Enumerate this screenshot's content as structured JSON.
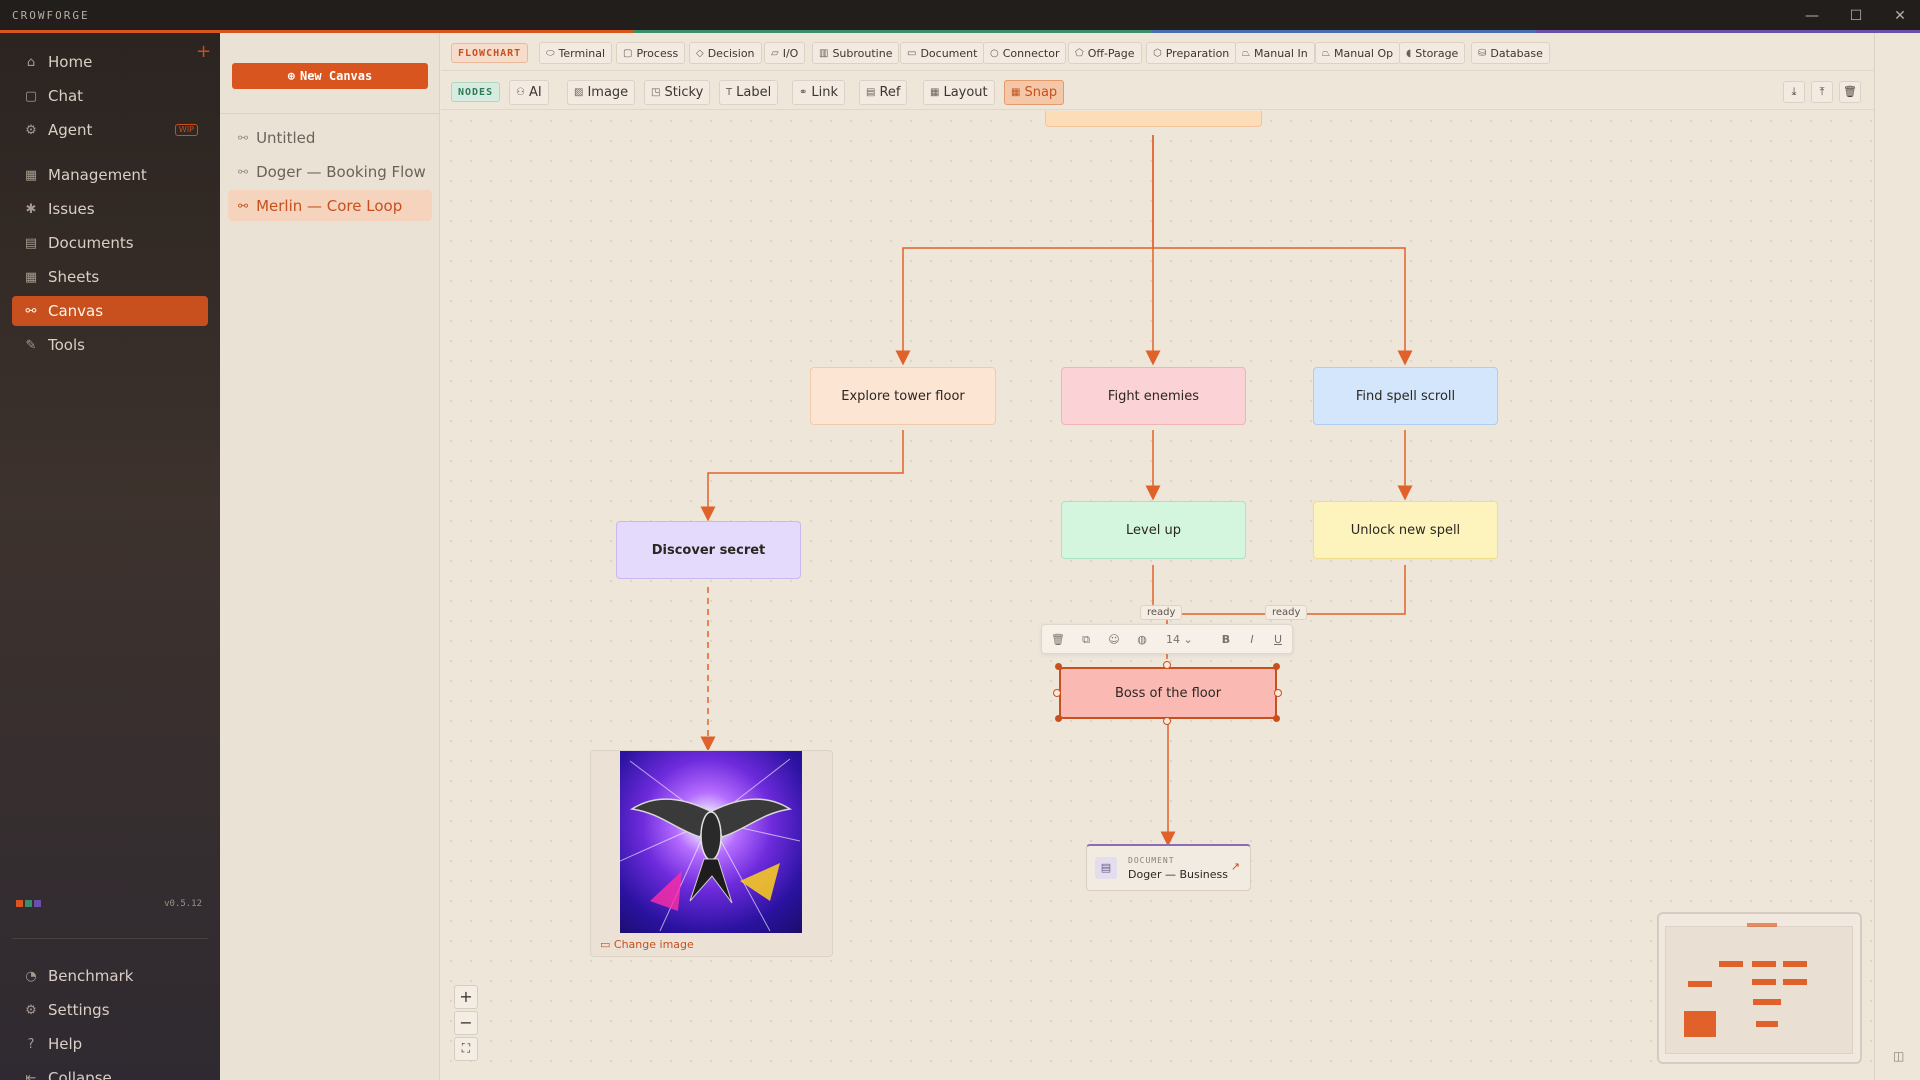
{
  "app": {
    "brand": "CROWFORGE",
    "version": "v0.5.12"
  },
  "window_controls": {
    "minimize": "—",
    "maximize": "☐",
    "close": "✕"
  },
  "sidebar": {
    "items": [
      {
        "label": "Home",
        "icon": "home-icon",
        "glyph": "⌂"
      },
      {
        "label": "Chat",
        "icon": "chat-icon",
        "glyph": "▢"
      },
      {
        "label": "Agent",
        "icon": "robot-icon",
        "glyph": "⚙",
        "badge": "WIP"
      },
      {
        "label": "Management",
        "icon": "grid-icon",
        "glyph": "▦"
      },
      {
        "label": "Issues",
        "icon": "bug-icon",
        "glyph": "✱"
      },
      {
        "label": "Documents",
        "icon": "document-icon",
        "glyph": "▤"
      },
      {
        "label": "Sheets",
        "icon": "table-icon",
        "glyph": "▦"
      },
      {
        "label": "Canvas",
        "icon": "canvas-icon",
        "glyph": "⚯",
        "active": true
      },
      {
        "label": "Tools",
        "icon": "wrench-icon",
        "glyph": "✎"
      }
    ],
    "bottom_items": [
      {
        "label": "Benchmark",
        "icon": "gauge-icon",
        "glyph": "◔"
      },
      {
        "label": "Settings",
        "icon": "gear-icon",
        "glyph": "⚙"
      },
      {
        "label": "Help",
        "icon": "help-icon",
        "glyph": "?"
      },
      {
        "label": "Collapse",
        "icon": "collapse-icon",
        "glyph": "⇤"
      }
    ],
    "add_glyph": "+",
    "swatch_colors": [
      "#d9551f",
      "#3a8f6a",
      "#6b4fa8"
    ]
  },
  "panel": {
    "new_canvas_label": "New Canvas",
    "new_canvas_glyph": "⊕",
    "canvases": [
      {
        "label": "Untitled"
      },
      {
        "label": "Doger — Booking Flow"
      },
      {
        "label": "Merlin — Core Loop",
        "active": true
      }
    ]
  },
  "toolbar_flowchart": {
    "tag": "FLOWCHART",
    "buttons": [
      {
        "label": "Terminal",
        "glyph": "⬭"
      },
      {
        "label": "Process",
        "glyph": "▢"
      },
      {
        "label": "Decision",
        "glyph": "◇"
      },
      {
        "label": "I/O",
        "glyph": "▱"
      },
      {
        "label": "Subroutine",
        "glyph": "▥"
      },
      {
        "label": "Document",
        "glyph": "▭"
      },
      {
        "label": "Connector",
        "glyph": "○"
      },
      {
        "label": "Off-Page",
        "glyph": "⬠"
      },
      {
        "label": "Preparation",
        "glyph": "⬡"
      },
      {
        "label": "Manual In",
        "glyph": "⏢"
      },
      {
        "label": "Manual Op",
        "glyph": "⏢"
      },
      {
        "label": "Storage",
        "glyph": "◖"
      },
      {
        "label": "Database",
        "glyph": "⛁"
      }
    ]
  },
  "toolbar_nodes": {
    "tag": "NODES",
    "buttons": [
      {
        "label": "AI",
        "glyph": "⚇"
      },
      {
        "label": "Image",
        "glyph": "▨"
      },
      {
        "label": "Sticky",
        "glyph": "◳"
      },
      {
        "label": "Label",
        "glyph": "T"
      },
      {
        "label": "Link",
        "glyph": "⚭"
      },
      {
        "label": "Ref",
        "glyph": "▤"
      },
      {
        "label": "Layout",
        "glyph": "▦"
      },
      {
        "label": "Snap",
        "glyph": "▦",
        "active": true
      }
    ],
    "right_actions": [
      {
        "name": "download",
        "glyph": "⤓"
      },
      {
        "name": "upload",
        "glyph": "⤒"
      },
      {
        "name": "delete",
        "glyph": "🗑"
      }
    ]
  },
  "nodes": [
    {
      "id": "explore",
      "label": "Explore tower floor",
      "fill": "#fde5d4",
      "border": "#f3c9ad"
    },
    {
      "id": "fight",
      "label": "Fight enemies",
      "fill": "#fbd3d6",
      "border": "#f0b3b8"
    },
    {
      "id": "find",
      "label": "Find spell scroll",
      "fill": "#d3e6fb",
      "border": "#aecdef"
    },
    {
      "id": "secret",
      "label": "Discover secret",
      "fill": "#e4dafb",
      "border": "#c9b8f0",
      "bold": true
    },
    {
      "id": "levelup",
      "label": "Level up",
      "fill": "#d4f6df",
      "border": "#a9e3bf"
    },
    {
      "id": "unlock",
      "label": "Unlock new spell",
      "fill": "#fdf3bd",
      "border": "#f0dd8a"
    },
    {
      "id": "boss",
      "label": "Boss of the floor",
      "fill": "#fbb9b4",
      "border": "#c8501e"
    }
  ],
  "edge_labels": [
    "ready",
    "ready"
  ],
  "format_bar": {
    "font_size": "14",
    "glyphs": [
      "🗑",
      "⧉",
      "☺",
      "◍",
      "B",
      "I",
      "U"
    ]
  },
  "image_node": {
    "change_label": "Change image",
    "change_glyph": "▭"
  },
  "doc_node": {
    "type": "DOCUMENT",
    "title": "Doger — Business",
    "glyph": "▤",
    "ext_glyph": "↗"
  },
  "zoom": {
    "in": "+",
    "out": "−",
    "fit": "⛶"
  },
  "accent": "#c8501e"
}
